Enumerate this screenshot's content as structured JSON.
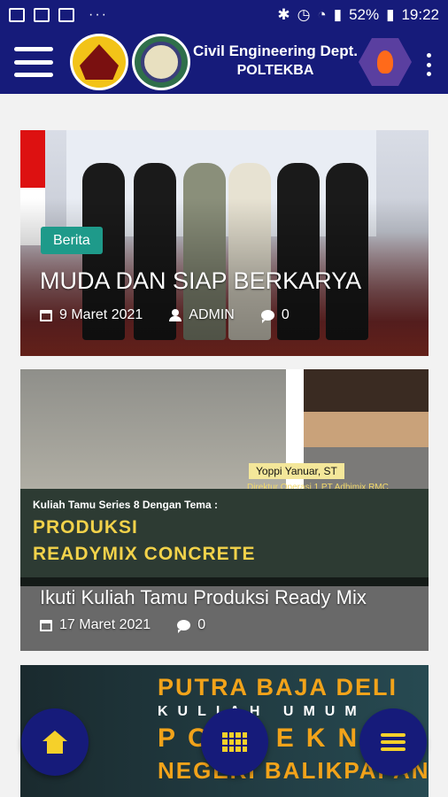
{
  "status_bar": {
    "battery": "52%",
    "time": "19:22",
    "icons": [
      "image-icon",
      "flipboard-icon",
      "linkedin-icon",
      "more-dots-icon",
      "bluetooth-icon",
      "alarm-icon",
      "wifi-icon",
      "signal-icon",
      "battery-icon"
    ]
  },
  "app_bar": {
    "title_line1": "Civil Engineering Dept.",
    "title_line2": "POLTEKBA"
  },
  "posts": [
    {
      "category": "Berita",
      "title": "MUDA DAN SIAP BERKARYA",
      "date": "9 Maret 2021",
      "author": "ADMIN",
      "comments": "0"
    },
    {
      "title": "Ikuti Kuliah Tamu Produksi Ready Mix",
      "date": "17 Maret 2021",
      "comments": "0",
      "image_text": {
        "speaker": "Yoppi Yanuar, ST",
        "speaker_role": "Direktur Operasi 1 PT Adhimix RMC",
        "series": "Kuliah Tamu Series 8 Dengan Tema :",
        "theme1": "PRODUKSI",
        "theme2": "READYMIX CONCRETE"
      }
    },
    {
      "image_text": {
        "l1": "PUTRA BAJA DELI",
        "l2": "KULIAH UMUM",
        "l3": "POLTEKN",
        "l4": "NEGERI BALIKPAPAN"
      }
    }
  ],
  "fabs": {
    "home": "home-icon",
    "grid": "grid-icon",
    "menu": "menu-icon"
  },
  "colors": {
    "primary": "#161b7a",
    "accent": "#f5d02a",
    "badge": "#1e9a8a"
  }
}
